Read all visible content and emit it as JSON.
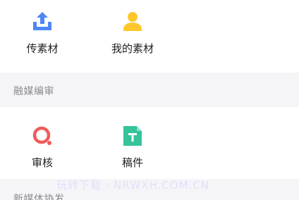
{
  "colors": {
    "background": "#f5f5f7",
    "panel": "#ffffff",
    "section_label": "#8a8a8f",
    "upload_icon": "#4e86f5",
    "my_icon": "#ffc72c",
    "review_icon": "#f05b5b",
    "draft_icon": "#35c39a"
  },
  "top": {
    "upload": {
      "label": "传素材",
      "icon": "upload-icon"
    },
    "my": {
      "label": "我的素材",
      "icon": "person-icon"
    }
  },
  "sections": {
    "media_edit": {
      "title": "融媒编审",
      "items": [
        {
          "label": "审核",
          "icon": "review-icon"
        },
        {
          "label": "稿件",
          "icon": "draft-document-icon"
        }
      ]
    },
    "new_media": {
      "title": "新媒体协发"
    }
  },
  "watermark": "玩转下载 · NRWXH.COM.CN"
}
